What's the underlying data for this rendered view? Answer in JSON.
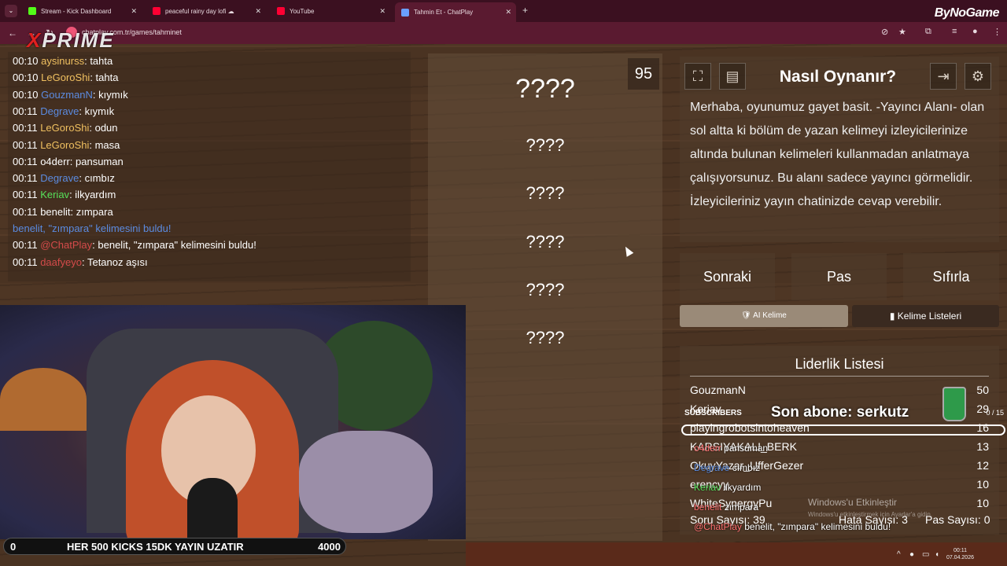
{
  "browser": {
    "tabs": [
      {
        "label": "Stream - Kick Dashboard",
        "icon": "kick-icon",
        "color": "#53fc18"
      },
      {
        "label": "peaceful rainy day lofi ☁",
        "icon": "youtube-icon",
        "color": "#ff0033"
      },
      {
        "label": "YouTube",
        "icon": "youtube-icon",
        "color": "#ff0033"
      },
      {
        "label": "Tahmin Et - ChatPlay",
        "icon": "chatplay-icon",
        "color": "#6aa0ff"
      }
    ],
    "new_tab": "+",
    "brand": "ByNoGame",
    "url": "chatplay.com.tr/games/tahminet",
    "overlay_logo": {
      "x_letter": "X",
      "rest": "PRIME"
    }
  },
  "chat": {
    "lines": [
      {
        "time": "00:10",
        "user": "aysinurss",
        "color": "y",
        "text": ": tahta"
      },
      {
        "time": "00:10",
        "user": "LeGoroShi",
        "color": "y",
        "text": ": tahta"
      },
      {
        "time": "00:10",
        "user": "GouzmanN",
        "color": "b",
        "text": ": kıymık"
      },
      {
        "time": "00:11",
        "user": "Degrave",
        "color": "b",
        "text": ": kıymık"
      },
      {
        "time": "00:11",
        "user": "LeGoroShi",
        "color": "y",
        "text": ": odun"
      },
      {
        "time": "00:11",
        "user": "LeGoroShi",
        "color": "y",
        "text": ": masa"
      },
      {
        "time": "00:11",
        "user": "o4derr",
        "color": "w",
        "text": ": pansuman"
      },
      {
        "time": "00:11",
        "user": "Degrave",
        "color": "b",
        "text": ": cımbız"
      },
      {
        "time": "00:11",
        "user": "Keriav",
        "color": "g",
        "text": ": ilkyardım"
      },
      {
        "time": "00:11",
        "user": "benelit",
        "color": "w",
        "text": ": zımpara"
      },
      {
        "time": "",
        "user": "benelit, \"zımpara\" kelimesini buldu!",
        "color": "sys",
        "text": ""
      },
      {
        "time": "00:11",
        "user": "@ChatPlay",
        "color": "r",
        "text": ": benelit, \"zımpara\" kelimesini buldu!"
      },
      {
        "time": "00:11",
        "user": "daafyeyo",
        "color": "r",
        "text": ": Tetanoz aşısı"
      }
    ]
  },
  "game": {
    "counter": "95",
    "words": [
      "????",
      "????",
      "????",
      "????",
      "????",
      "????"
    ]
  },
  "howto": {
    "title": "Nasıl Oynanır?",
    "text": "Merhaba, oyunumuz gayet basit. -Yayıncı Alanı- olan sol altta ki bölüm de yazan kelimeyi izleyicilerinize altında bulunan kelimeleri kullanmadan anlatmaya çalışıyorsunuz. Bu alanı sadece yayıncı görmelidir. İzleyicileriniz yayın chatinizde cevap verebilir.",
    "icons": [
      "fullscreen-icon",
      "notes-icon",
      "exit-icon",
      "gear-icon"
    ]
  },
  "actions": {
    "next": "Sonraki",
    "pass": "Pas",
    "reset": "Sıfırla",
    "ai_word": "AI Kelime",
    "word_lists": "Kelime Listeleri"
  },
  "leaderboard": {
    "title": "Liderlik Listesi",
    "rows": [
      {
        "name": "GouzmanN",
        "score": "50"
      },
      {
        "name": "Keriav",
        "score": "29"
      },
      {
        "name": "playingrobotsintoheaven",
        "score": "16"
      },
      {
        "name": "KARSIYAKALI_BERK",
        "score": "13"
      },
      {
        "name": "OkuyYazar_UfferGezer",
        "score": "12"
      },
      {
        "name": "erencyy",
        "score": "10"
      },
      {
        "name": "WhiteSynergyPu",
        "score": "10"
      }
    ],
    "question_count": "Soru Sayısı: 39",
    "error_count": "Hata Sayısı: 3",
    "pass_count": "Pas Sayısı: 0"
  },
  "overlay": {
    "subscribers_label": "SUBSCRIBERS",
    "last_sub": "Son abone: serkutz",
    "subs_count": "0 / 15",
    "chat": [
      {
        "user": "o4derr",
        "text": "pansuman"
      },
      {
        "user": "Degrave",
        "text": "cımbız"
      },
      {
        "user": "Keriav",
        "text": "ilkyardım"
      },
      {
        "user": "benelit",
        "text": "zımpara"
      },
      {
        "user": "@ChatPlay",
        "text": "benelit, \"zımpara\" kelimesini buldu!"
      },
      {
        "user": "daafyeyo",
        "text": "Tetanoz aşısı"
      }
    ],
    "windows_activate": "Windows'u Etkinleştir",
    "windows_activate_sub": "Windows'u etkinleştirmek için Ayarlar'a gidin."
  },
  "banner": {
    "left": "0",
    "text": "HER 500 KICKS 15DK YAYIN UZATIR",
    "right": "4000"
  },
  "taskbar": {
    "time": "00:11",
    "date": "07.04.2026"
  }
}
